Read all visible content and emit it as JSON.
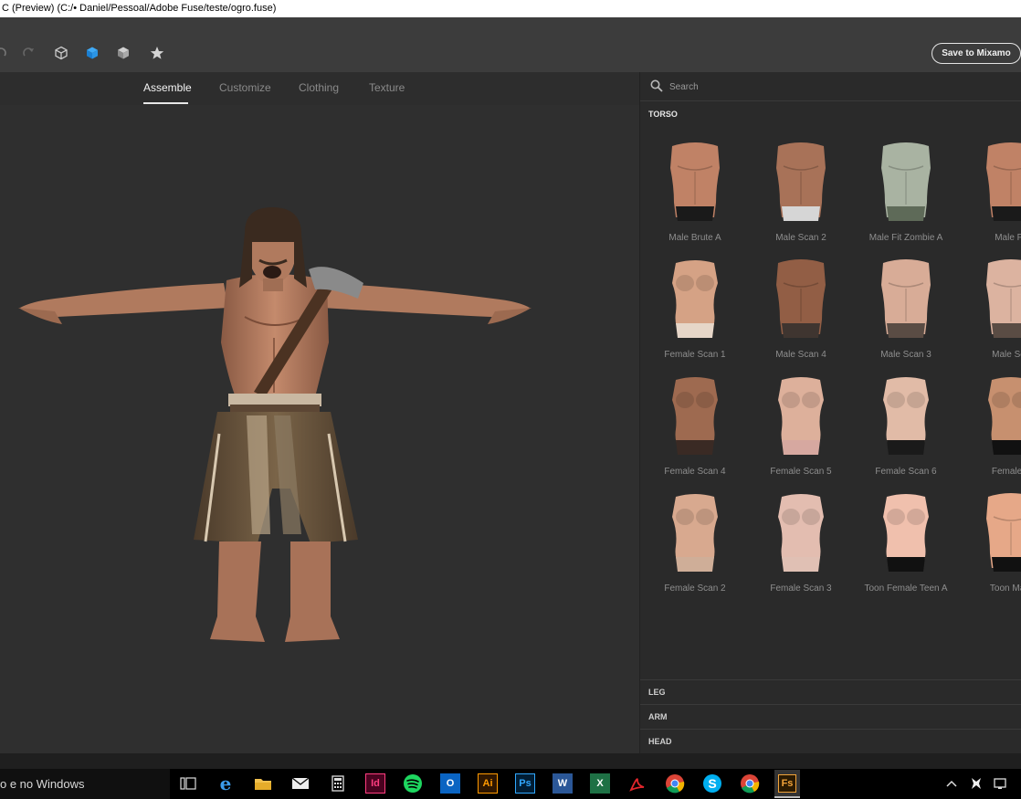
{
  "window": {
    "title": "C (Preview) (C:/• Daniel/Pessoal/Adobe Fuse/teste/ogro.fuse)"
  },
  "toolbar": {
    "save_label": "Save to Mixamo",
    "icons": [
      "undo-icon",
      "redo-icon",
      "cube-outline-icon",
      "cube-solid-icon",
      "cube-shaded-icon",
      "star-icon"
    ]
  },
  "tabs": [
    {
      "label": "Assemble",
      "active": true
    },
    {
      "label": "Customize",
      "active": false
    },
    {
      "label": "Clothing",
      "active": false
    },
    {
      "label": "Texture",
      "active": false
    }
  ],
  "panel": {
    "search_placeholder": "Search",
    "section_title": "TORSO",
    "items": [
      {
        "label": "Male Brute A",
        "skin": "#c08266",
        "bottom": "#1a1a1a",
        "type": "male"
      },
      {
        "label": "Male Scan 2",
        "skin": "#a87258",
        "bottom": "#d6d6d6",
        "type": "male"
      },
      {
        "label": "Male Fit Zombie A",
        "skin": "#a9b3a2",
        "bottom": "#5e6a58",
        "type": "male"
      },
      {
        "label": "Male Fit",
        "skin": "#c08266",
        "bottom": "#1a1a1a",
        "type": "male"
      },
      {
        "label": "Female Scan 1",
        "skin": "#d5a285",
        "bottom": "#e6d6c8",
        "type": "female"
      },
      {
        "label": "Male Scan 4",
        "skin": "#925e45",
        "bottom": "#3f3530",
        "type": "male"
      },
      {
        "label": "Male Scan 3",
        "skin": "#d8ac97",
        "bottom": "#5a4c44",
        "type": "male"
      },
      {
        "label": "Male Sca",
        "skin": "#dcb3a0",
        "bottom": "#5a4c44",
        "type": "male"
      },
      {
        "label": "Female Scan 4",
        "skin": "#9e6a50",
        "bottom": "#3a2a24",
        "type": "female"
      },
      {
        "label": "Female Scan 5",
        "skin": "#ddb09b",
        "bottom": "#d6a8a0",
        "type": "female"
      },
      {
        "label": "Female Scan 6",
        "skin": "#e1bba7",
        "bottom": "#1a1a1a",
        "type": "female"
      },
      {
        "label": "Female F",
        "skin": "#c7906f",
        "bottom": "#111111",
        "type": "female"
      },
      {
        "label": "Female Scan 2",
        "skin": "#d8a98f",
        "bottom": "#cfae98",
        "type": "female"
      },
      {
        "label": "Female Scan 3",
        "skin": "#e3bdb0",
        "bottom": "#e0c0b4",
        "type": "female"
      },
      {
        "label": "Toon Female Teen A",
        "skin": "#f0c0ad",
        "bottom": "#111111",
        "type": "female"
      },
      {
        "label": "Toon Male",
        "skin": "#e6a888",
        "bottom": "#111111",
        "type": "male"
      }
    ],
    "sections": [
      "LEG",
      "ARM",
      "HEAD"
    ]
  },
  "taskbar": {
    "search_text": "o e no Windows",
    "apps": [
      "task-view",
      "edge",
      "file-explorer",
      "mail",
      "calculator",
      "indesign",
      "spotify",
      "outlook",
      "illustrator",
      "photoshop",
      "word",
      "excel",
      "acrobat",
      "chrome",
      "skype",
      "chrome-2",
      "fuse"
    ],
    "app_labels": {
      "indesign": "Id",
      "illustrator": "Ai",
      "photoshop": "Ps",
      "fuse": "Fs",
      "word": "W",
      "excel": "X",
      "outlook": "O"
    }
  }
}
